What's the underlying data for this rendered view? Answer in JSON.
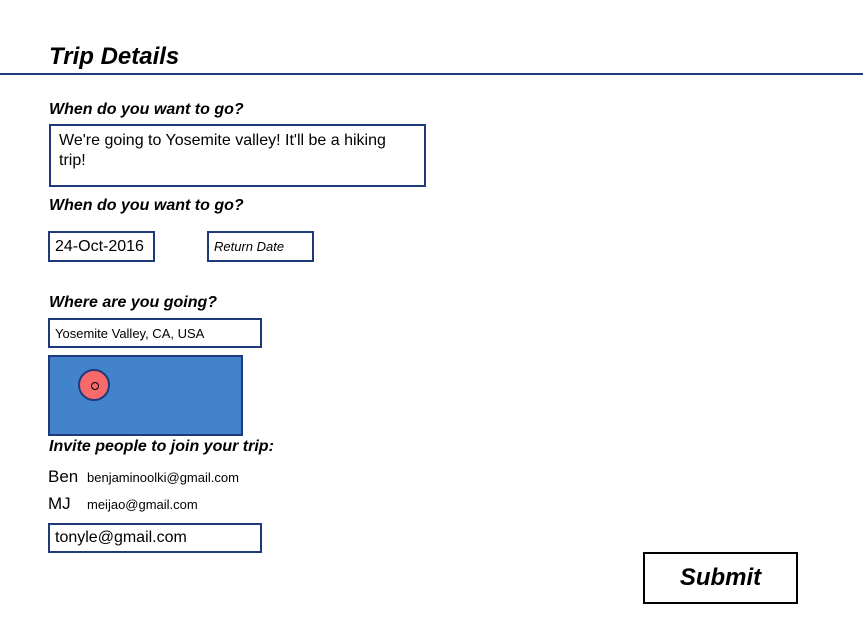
{
  "header": {
    "title": "Trip Details"
  },
  "description_section": {
    "label": "When do you want to go?",
    "value": "We're going to Yosemite valley! It'll be a hiking trip!"
  },
  "dates_section": {
    "label": "When do you want to go?",
    "depart_value": "24-Oct-2016",
    "return_placeholder": "Return Date"
  },
  "location_section": {
    "label": "Where are you going?",
    "value": "Yosemite Valley, CA, USA",
    "map_color": "#4283cc",
    "pin_color": "#f8696b"
  },
  "invite_section": {
    "label": "Invite people to join your trip:",
    "invitees": [
      {
        "name": "Ben",
        "email": "benjaminoolki@gmail.com"
      },
      {
        "name": "MJ",
        "email": "meijao@gmail.com"
      }
    ],
    "input_value": "tonyle@gmail.com"
  },
  "actions": {
    "submit_label": "Submit"
  },
  "colors": {
    "border": "#1f3a7a",
    "accent": "#4283cc"
  }
}
